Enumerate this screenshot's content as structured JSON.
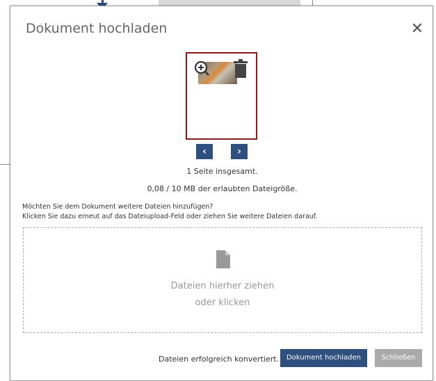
{
  "modal": {
    "title": "Dokument hochladen",
    "close_symbol": "✕"
  },
  "preview": {
    "zoom_icon": "zoom-in-icon",
    "trash_icon": "trash-icon",
    "prev_symbol": "‹",
    "next_symbol": "›"
  },
  "info": {
    "pages_text": "1 Seite insgesamt.",
    "size_text": "0,08 / 10 MB der erlaubten Dateigröße."
  },
  "hint": {
    "line1": "Möchten Sie dem Dokument weitere Dateien hinzufügen?",
    "line2": "Klicken Sie dazu erneut auf das Dateiupload-Feld oder ziehen Sie weitere Dateien darauf."
  },
  "dropzone": {
    "icon": "file-icon",
    "line1": "Dateien hierher ziehen",
    "line2": "oder klicken"
  },
  "footer": {
    "status": "Dateien erfolgreich konvertiert.",
    "upload_label": "Dokument hochladen",
    "close_label": "Schließen"
  },
  "colors": {
    "primary": "#2f4f7f",
    "thumb_border": "#8b1a1a",
    "secondary_button": "#aaaaaa"
  }
}
